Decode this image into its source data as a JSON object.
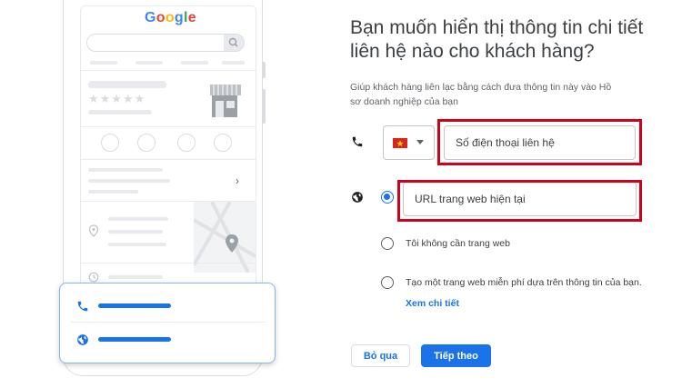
{
  "illustration": {
    "search_logo": "Google",
    "logo_colors": [
      "#4285f4",
      "#ea4335",
      "#fbbc05",
      "#4285f4",
      "#34a853",
      "#ea4335"
    ],
    "card_icons": [
      "phone-icon",
      "globe-icon"
    ]
  },
  "form": {
    "title": "Bạn muốn hiển thị thông tin chi tiết liên hệ nào cho khách hàng?",
    "subtitle": "Giúp khách hàng liên lạc bằng cách đưa thông tin này vào Hồ sơ doanh nghiệp của bạn",
    "phone": {
      "country_flag": "vietnam-flag",
      "placeholder": "Số điện thoại liên hệ"
    },
    "website": {
      "url_placeholder": "URL trang web hiện tại",
      "options": [
        {
          "label": "URL trang web hiện tại",
          "selected": true
        },
        {
          "label": "Tôi không cần trang web",
          "selected": false
        },
        {
          "label": "Tạo một trang web miễn phí dựa trên thông tin của bạn.",
          "selected": false
        }
      ],
      "learn_more": "Xem chi tiết"
    },
    "skip_label": "Bỏ qua",
    "next_label": "Tiếp theo"
  },
  "colors": {
    "accent": "#1a73e8",
    "highlight": "#d0021b"
  }
}
